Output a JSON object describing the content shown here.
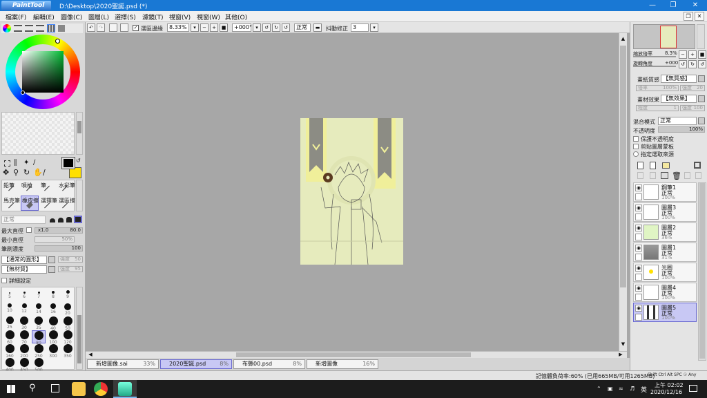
{
  "title": {
    "app": "PaintTool SAI",
    "path": "D:\\Desktop\\2020聖誕.psd (*)"
  },
  "menu": [
    "檔案(F)",
    "編輯(E)",
    "圖像(C)",
    "圖層(L)",
    "選擇(S)",
    "濾鏡(T)",
    "視窗(V)",
    "視窗(W)",
    "其他(O)"
  ],
  "toolbar": {
    "selection_edge": "選區邊緣",
    "zoom": "8.33%",
    "angle": "+000°",
    "mode": "正常",
    "stabilizer_label": "抖動修正",
    "stabilizer": "3"
  },
  "tools": {
    "row1": [
      "鉛筆",
      "噴槍",
      "筆",
      "水彩筆"
    ],
    "row2": [
      "馬克筆",
      "橡皮擦",
      "選擇筆",
      "選區擦"
    ],
    "mode": "正常",
    "max_dia_label": "最大直徑",
    "max_dia_mult": "x1.0",
    "max_dia": "80.0",
    "min_dia_label": "最小直徑",
    "min_dia": "50%",
    "density_label": "筆刷濃度",
    "density": "100",
    "shape": "【通常的圓形】",
    "shape_strength_label": "強度",
    "shape_strength": "50",
    "texture": "【無材質】",
    "texture_strength_label": "強度",
    "texture_strength": "95",
    "detail": "詳細設定",
    "sizes": [
      "5",
      "6",
      "7",
      "8",
      "9",
      "10",
      "12",
      "14",
      "16",
      "20",
      "25",
      "30",
      "35",
      "40",
      "50",
      "60",
      "70",
      "80",
      "100",
      "120",
      "160",
      "200",
      "250",
      "300",
      "350",
      "400",
      "450",
      "500"
    ]
  },
  "navigator": {
    "zoom_label": "縮放倍率",
    "zoom": "8.3%",
    "angle_label": "旋轉角度",
    "angle": "+000"
  },
  "paper": {
    "label": "畫紙質感",
    "value": "【無質感】",
    "scale_label": "倍率",
    "scale": "100%",
    "strength_label": "強度",
    "strength": "20"
  },
  "effect": {
    "label": "畫材效果",
    "value": "【無效果】",
    "degree_label": "程度",
    "degree": "1",
    "strength_label": "強度",
    "strength": "100"
  },
  "blend": {
    "label": "混合模式",
    "value": "正常",
    "opacity_label": "不透明度",
    "opacity": "100%"
  },
  "options": [
    "保護不透明度",
    "剪貼圖層蒙板",
    "指定選取來源"
  ],
  "layers": [
    {
      "name": "鋼筆1",
      "mode": "正常",
      "opacity": "100%"
    },
    {
      "name": "圖層3",
      "mode": "正常",
      "opacity": "100%"
    },
    {
      "name": "圖層2",
      "mode": "正常",
      "opacity": "36%"
    },
    {
      "name": "圖層1",
      "mode": "正常",
      "opacity": "31%"
    },
    {
      "name": "光圈",
      "mode": "正常",
      "opacity": "100%"
    },
    {
      "name": "圖層4",
      "mode": "正常",
      "opacity": "100%"
    },
    {
      "name": "圖層5",
      "mode": "正常",
      "opacity": "100%"
    }
  ],
  "tabs": [
    {
      "name": "新增圖像.sai",
      "pct": "33%"
    },
    {
      "name": "2020聖誕.psd",
      "pct": "8%"
    },
    {
      "name": "布縣00.psd",
      "pct": "8%"
    },
    {
      "name": "新增圖像",
      "pct": "16%"
    }
  ],
  "status": {
    "memory": "記憶體負荷率:60% (已用665MB/可用1265MB)",
    "keys": "Shift Ctrl Alt SPC ☉ Any"
  },
  "taskbar": {
    "time": "上午 02:02",
    "date": "2020/12/16",
    "ime": "英"
  }
}
